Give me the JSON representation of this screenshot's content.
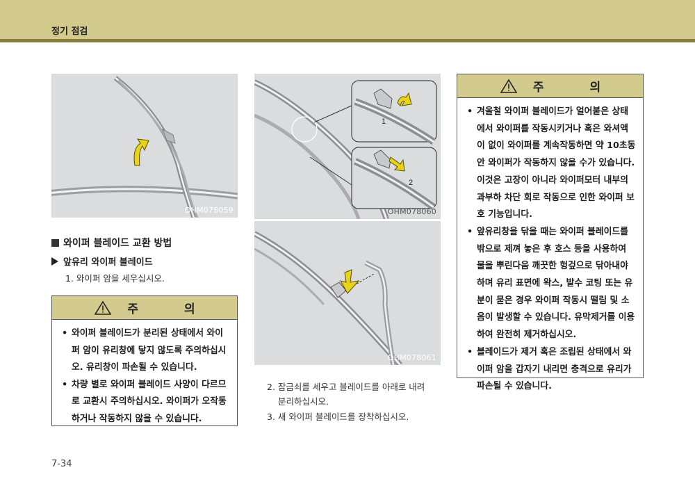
{
  "header": {
    "title": "정기 점검"
  },
  "figures": {
    "fig1": {
      "code": "OHM078059"
    },
    "fig2": {
      "code": "OHM078060",
      "callout1": "1",
      "callout2": "2"
    },
    "fig3": {
      "code": "OHM078061"
    }
  },
  "section": {
    "heading": "와이퍼 블레이드 교환 방법",
    "subheading": "앞유리 와이퍼 블레이드",
    "step1": "1. 와이퍼 암을 세우십시오.",
    "step2_line1": "2. 잠금쇠를 세우고 블레이드를 아래로 내려",
    "step2_line2": "분리하십시오.",
    "step3": "3. 새 와이퍼 블레이드를 장착하십시오."
  },
  "caution_left": {
    "title": "주 의",
    "icon": "warning-triangle-icon",
    "items": [
      "와이퍼 블레이드가 분리된 상태에서 와이퍼 암이 유리창에 닿지 않도록 주의하십시오. 유리창이 파손될 수 있습니다.",
      "차량 별로 와이퍼 블레이드 사양이 다르므로 교환시 주의하십시오. 와이퍼가 오작동하거나 작동하지 않을 수 있습니다."
    ]
  },
  "caution_right": {
    "title": "주 의",
    "icon": "warning-triangle-icon",
    "items": [
      "겨울철 와이퍼 블레이드가 얼어붙은 상태에서 와이퍼를 작동시키거나 혹은 와셔액이 없이 와이퍼를 계속작동하면 약 10초동안 와이퍼가 작동하지 않을 수가 있습니다. 이것은 고장이 아니라 와이퍼모터 내부의 과부하 차단 회로 작동으로 인한 와이퍼 보호 기능입니다.",
      "앞유리창을 닦을 때는 와이퍼 블레이드를 밖으로 제껴 놓은 후 호스 등을 사용하여 물을 뿌린다음 깨끗한 헝겊으로 닦아내야 하며 유리 표면에 왁스, 발수 코팅 또는 유분이 묻은 경우 와이퍼 작동시 떨림 및 소음이 발생할 수 있습니다. 유막제거를 이용하여 완전히 제거하십시오.",
      "블레이드가 제거 혹은 조립된 상태에서 와이퍼 암을 갑자기 내리면 충격으로 유리가 파손될 수 있습니다."
    ]
  },
  "page_number": "7-34",
  "colors": {
    "header_bg": "#d2cb8d",
    "header_rule": "#8a7f40",
    "arrow_yellow": "#e8d21a",
    "figure_bg": "#dadcde"
  }
}
